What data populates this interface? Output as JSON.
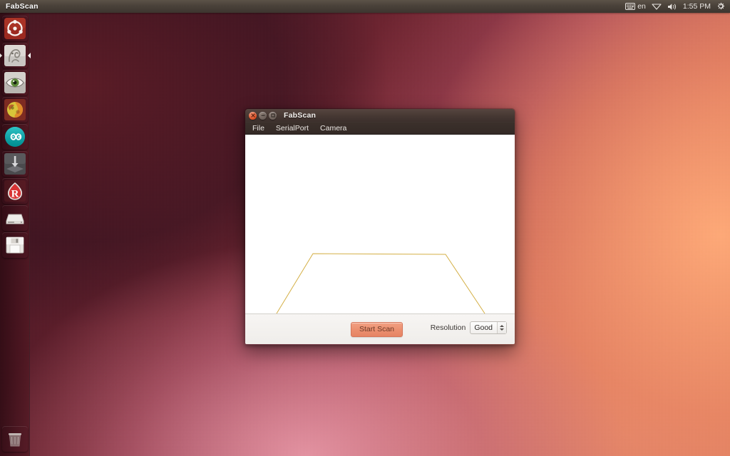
{
  "panel": {
    "title": "FabScan",
    "indicators": {
      "keyboard_icon": "keyboard-icon",
      "keyboard_layout": "en",
      "network_icon": "network-icon",
      "volume_icon": "volume-icon",
      "clock": "1:55 PM",
      "session_icon": "gear-power-icon"
    }
  },
  "launcher": {
    "items": [
      {
        "name": "dash-home",
        "icon": "ubuntu-dash-icon",
        "running": false
      },
      {
        "name": "files",
        "icon": "nautilus-files-icon",
        "running": true
      },
      {
        "name": "eye-viewer",
        "icon": "eye-icon",
        "running": false
      },
      {
        "name": "firefox",
        "icon": "firefox-globe-icon",
        "running": false
      },
      {
        "name": "arduino-ide",
        "icon": "arduino-infinity-icon",
        "running": false
      },
      {
        "name": "software-updater",
        "icon": "download-arrow-icon",
        "running": false
      },
      {
        "name": "rstudio",
        "icon": "letter-r-icon",
        "running": false
      },
      {
        "name": "disk-drive",
        "icon": "disk-drive-icon",
        "running": false
      },
      {
        "name": "save-floppy",
        "icon": "floppy-disk-icon",
        "running": false
      }
    ],
    "trash": {
      "name": "trash",
      "icon": "trash-bin-icon"
    }
  },
  "window": {
    "title": "FabScan",
    "controls": {
      "close": "close-icon",
      "minimize": "minimize-icon",
      "maximize": "maximize-icon"
    },
    "menu": [
      {
        "label": "File"
      },
      {
        "label": "SerialPort"
      },
      {
        "label": "Camera"
      }
    ],
    "statusbar": {
      "start_scan_label": "Start Scan",
      "resolution_label": "Resolution",
      "resolution_value": "Good",
      "resolution_options": [
        "Good"
      ]
    }
  },
  "chart_data": {
    "type": "line",
    "title": "",
    "xlabel": "",
    "ylabel": "",
    "stroke_color": "#d4af45",
    "stroke_width": 1,
    "grid": false,
    "legend": null,
    "xlim": [
      0,
      380
    ],
    "ylim": [
      0,
      251
    ],
    "description": "Scan profile outline: open trapezoid drawn on white canvas",
    "series": [
      {
        "name": "scan-profile",
        "points": [
          [
            44,
            251
          ],
          [
            95,
            167
          ],
          [
            281,
            168
          ],
          [
            336,
            251
          ]
        ]
      }
    ]
  }
}
